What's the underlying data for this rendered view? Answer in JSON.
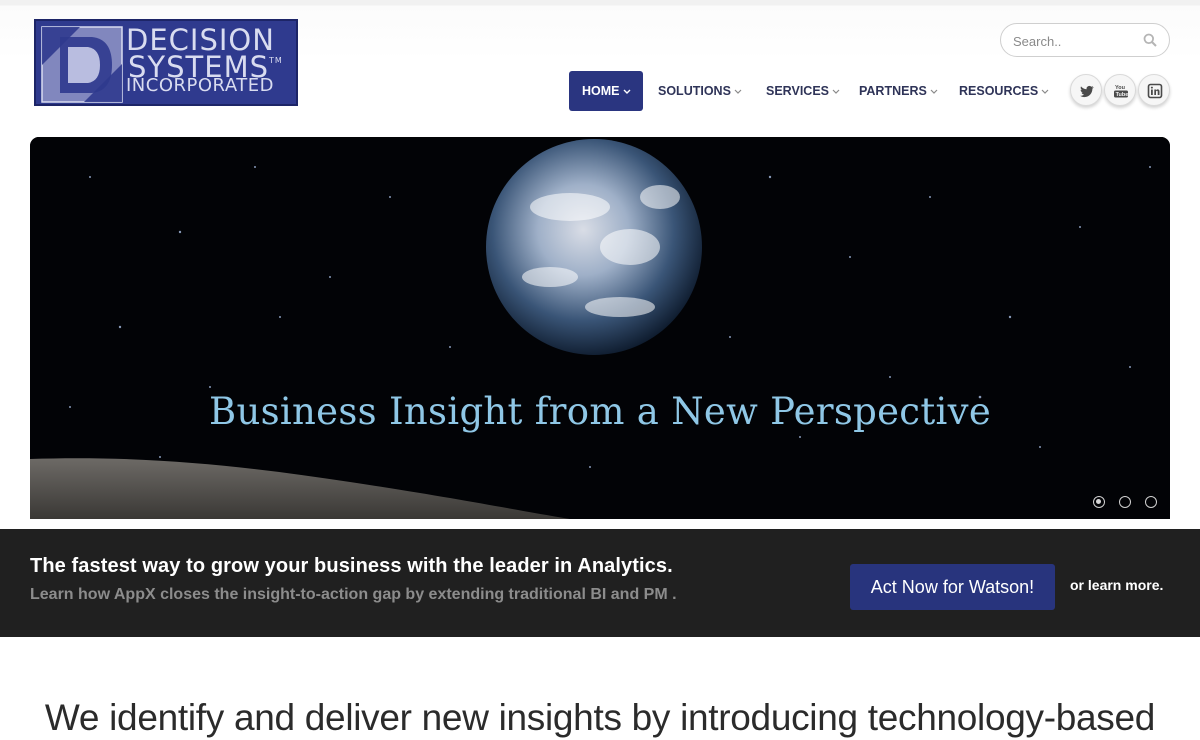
{
  "brand": {
    "logo_line1": "DECISION",
    "logo_line2": "SYSTEMS",
    "logo_tm": "TM",
    "logo_line3": "INCORPORATED",
    "colors": {
      "primary": "#2a3580",
      "logo_bg": "#2f3a8e",
      "cta_band": "#202020",
      "hero_text": "#8fc7e6"
    }
  },
  "search": {
    "placeholder": "Search..",
    "icon": "magnifier-icon"
  },
  "nav": {
    "items": [
      {
        "label": "HOME",
        "active": true
      },
      {
        "label": "SOLUTIONS",
        "active": false
      },
      {
        "label": "SERVICES",
        "active": false
      },
      {
        "label": "PARTNERS",
        "active": false
      },
      {
        "label": "RESOURCES",
        "active": false
      }
    ]
  },
  "social": [
    {
      "name": "twitter-icon"
    },
    {
      "name": "youtube-icon"
    },
    {
      "name": "linkedin-icon"
    }
  ],
  "hero": {
    "title": "Business Insight from a New Perspective",
    "slides_total": 3,
    "slide_active": 1
  },
  "cta": {
    "title": "The fastest way to grow your business with the leader in Analytics.",
    "subtitle": "Learn how AppX closes the insight-to-action gap by extending traditional BI and PM .",
    "button": "Act Now for Watson!",
    "learn_more": "or learn more."
  },
  "intro": {
    "headline": "We identify and deliver new insights by introducing technology-based"
  }
}
